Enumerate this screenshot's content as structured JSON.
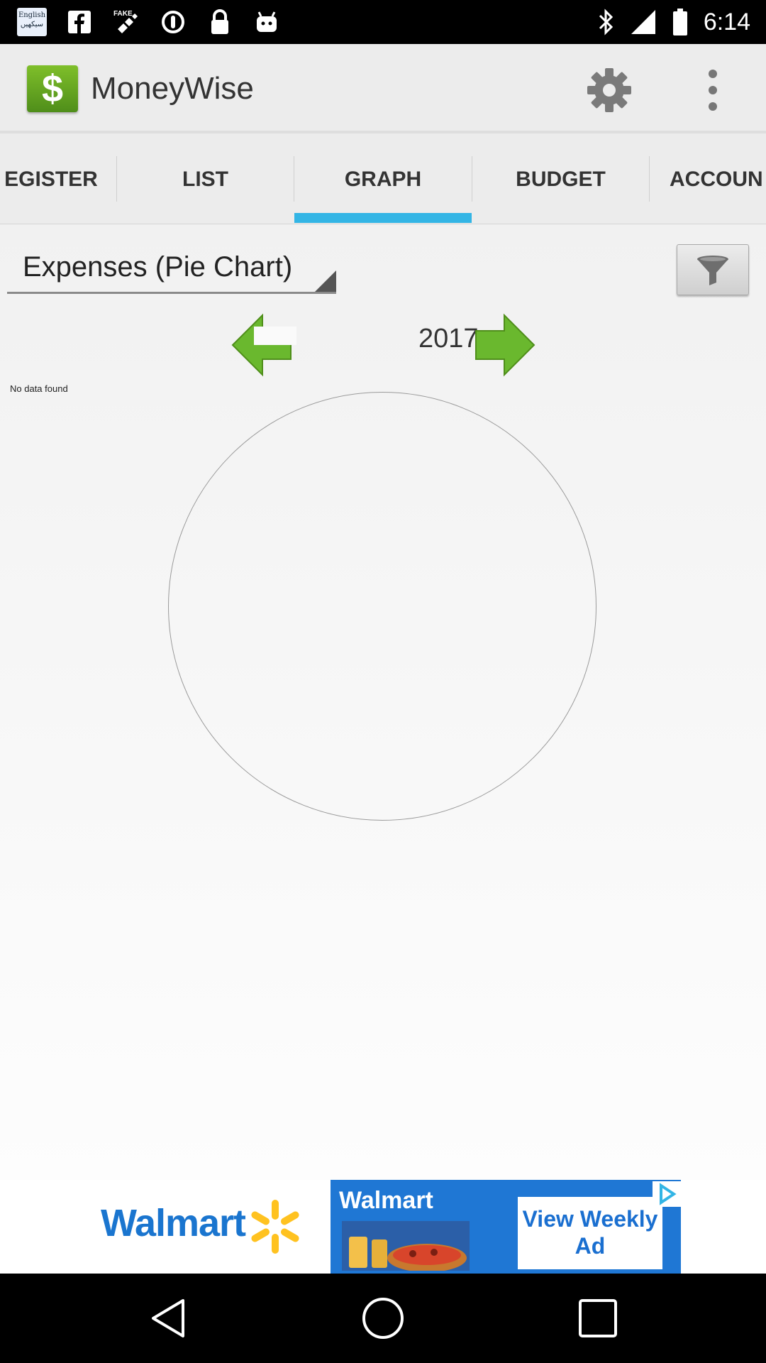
{
  "status_bar": {
    "time": "6:14",
    "lang_line1": "English",
    "lang_line2": "سیکھیں",
    "icons": [
      "language-badge-icon",
      "facebook-icon",
      "fake-gps-icon",
      "alarm-icon",
      "lock-icon",
      "android-icon",
      "bluetooth-icon",
      "signal-icon",
      "battery-icon"
    ]
  },
  "app_bar": {
    "title": "MoneyWise",
    "logo_glyph": "$",
    "icons": [
      "money-logo-icon",
      "gear-icon",
      "overflow-menu-icon"
    ]
  },
  "tabs": [
    {
      "label": "EGISTER",
      "active": false
    },
    {
      "label": "LIST",
      "active": false
    },
    {
      "label": "GRAPH",
      "active": true
    },
    {
      "label": "BUDGET",
      "active": false
    },
    {
      "label": "ACCOUN",
      "active": false
    }
  ],
  "graph": {
    "chart_selector": "Expenses (Pie Chart)",
    "period": "2017",
    "empty_message": "No data found",
    "icons": [
      "filter-icon",
      "prev-arrow-icon",
      "next-arrow-icon"
    ]
  },
  "ad": {
    "brand": "Walmart",
    "banner_brand": "Walmart",
    "cta": "View Weekly Ad"
  },
  "colors": {
    "accent": "#33b5e5",
    "arrow_green": "#6ab82e",
    "walmart_blue": "#1a75cf",
    "walmart_yellow": "#ffc220"
  }
}
